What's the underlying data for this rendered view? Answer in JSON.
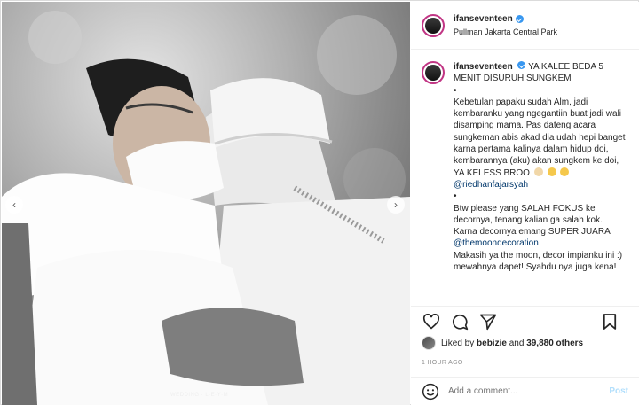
{
  "post": {
    "username": "ifanseventeen",
    "location": "Pullman Jakarta Central Park",
    "photo_watermark": "WEDDING · L·E·Y·M",
    "caption": {
      "author": "ifanseventeen",
      "headline": "YA KALEE BEDA 5 MENIT DISURUH SUNGKEM",
      "bullet1": "•",
      "para1": "Kebetulan papaku sudah Alm, jadi kembaranku yang ngegantiin buat jadi wali disamping mama. Pas dateng acara sungkeman abis akad dia udah hepi banget karna pertama kalinya dalam hidup doi, kembarannya (aku) akan sungkem ke doi, YA KELESS BROO",
      "mention1": "@riedhanfajarsyah",
      "bullet2": "•",
      "para2": "Btw please yang SALAH FOKUS ke decornya, tenang kalian ga salah kok. Karna decornya emang SUPER JUARA",
      "mention2": "@themoondecoration",
      "para3": "Makasih ya the moon, decor impianku ini :) mewahnya dapet! Syahdu nya juga kena!"
    },
    "likes": {
      "prefix": "Liked by",
      "user": "bebizie",
      "and": "and",
      "count": "39,880 others"
    },
    "time_ago": "1 HOUR AGO",
    "comment": {
      "placeholder": "Add a comment...",
      "post_label": "Post"
    }
  },
  "icons": {
    "prev": "chevron-left-icon",
    "next": "chevron-right-icon",
    "like": "heart-icon",
    "comment": "comment-icon",
    "share": "paper-plane-icon",
    "save": "bookmark-icon",
    "emoji": "smiley-icon"
  },
  "colors": {
    "verified": "#3897f0",
    "mention": "#00376b",
    "post_disabled": "#b2dffc",
    "muted": "#8e8e8e"
  }
}
